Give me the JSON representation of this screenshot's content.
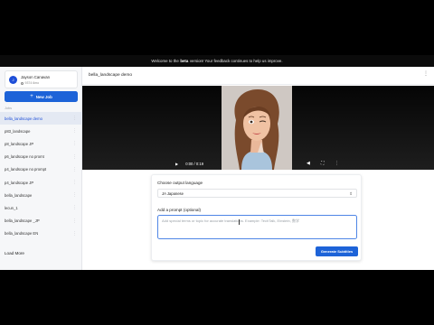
{
  "banner": {
    "text_before": "Welcome to the",
    "text_bold": "beta",
    "text_after": "version! Your feedback continues to help us improve."
  },
  "user": {
    "name": "Jayson Canavan",
    "credits": "9374 6mo"
  },
  "sidebar": {
    "new_job_label": "New Job",
    "jobs_label": "Jobs",
    "jobs": [
      {
        "label": "bella_landscape demo",
        "active": true
      },
      {
        "label": "p83_landscape",
        "active": false
      },
      {
        "label": "p8_landscape JP",
        "active": false
      },
      {
        "label": "p6_landscape no promt",
        "active": false
      },
      {
        "label": "p4_landscape no prompt",
        "active": false
      },
      {
        "label": "p4_landscape JP",
        "active": false
      },
      {
        "label": "bella_landscape",
        "active": false
      },
      {
        "label": "lecun_1",
        "active": false
      },
      {
        "label": "bella_landscape _JP",
        "active": false
      },
      {
        "label": "bella_landscape EN",
        "active": false
      }
    ],
    "load_more": "Load More"
  },
  "main": {
    "title": "bella_landscape demo",
    "video": {
      "time": "0:00 / 0:19",
      "progress": 0.02
    },
    "form": {
      "language_label": "Choose output language",
      "language_value": "JA Japanese",
      "prompt_label": "Add a prompt (optional)",
      "prompt_placeholder": "Add special terms or topic for accurate translations. Example: TechTalk, Einstein, 数学",
      "generate_label": "Generate Subtitles"
    }
  },
  "colors": {
    "accent": "#1d63d8",
    "active_bg": "#e4e9f3",
    "banner_bg": "#0b0b0b"
  }
}
